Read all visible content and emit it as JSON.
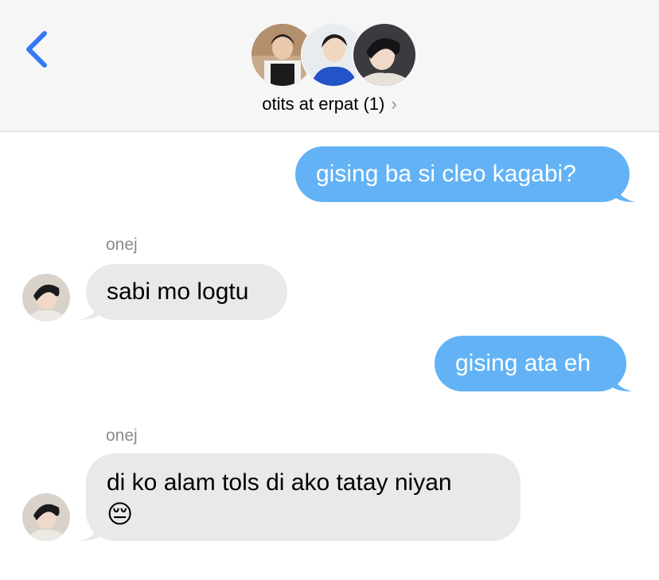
{
  "header": {
    "back_label": "‹",
    "group_name": "otits at erpat (1)",
    "chevron": "›"
  },
  "messages": [
    {
      "direction": "outgoing",
      "text": "gising ba si cleo kagabi?"
    },
    {
      "direction": "incoming",
      "sender": "onej",
      "text": "sabi mo logtu"
    },
    {
      "direction": "outgoing",
      "text": "gising ata eh"
    },
    {
      "direction": "incoming",
      "sender": "onej",
      "text": "di ko alam tols di ako tatay niyan",
      "emoji": "😔"
    }
  ],
  "colors": {
    "outgoing_bubble": "#62b2f5",
    "incoming_bubble": "#e9e9ec",
    "accent": "#3478f6"
  }
}
